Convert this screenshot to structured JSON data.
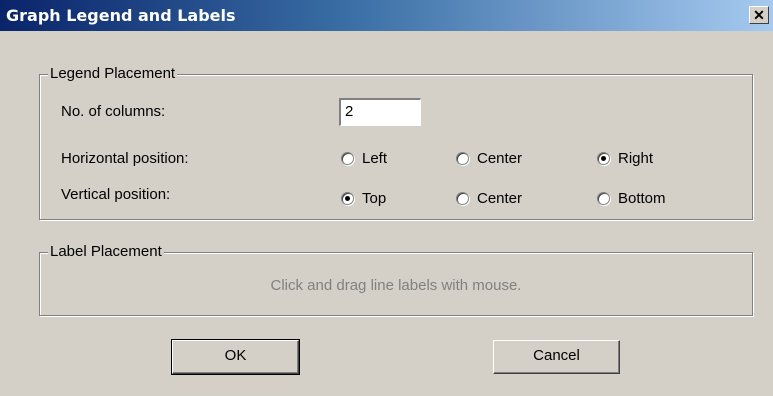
{
  "window": {
    "title": "Graph Legend and Labels",
    "close_glyph": "✕"
  },
  "legend_placement": {
    "group_title": "Legend Placement",
    "columns_label": "No. of columns:",
    "columns_value": "2",
    "horizontal_label": "Horizontal position:",
    "horizontal_options": [
      "Left",
      "Center",
      "Right"
    ],
    "horizontal_selected": "Right",
    "vertical_label": "Vertical position:",
    "vertical_options": [
      "Top",
      "Center",
      "Bottom"
    ],
    "vertical_selected": "Top"
  },
  "label_placement": {
    "group_title": "Label Placement",
    "hint": "Click and drag line labels with mouse."
  },
  "buttons": {
    "ok": "OK",
    "cancel": "Cancel"
  }
}
